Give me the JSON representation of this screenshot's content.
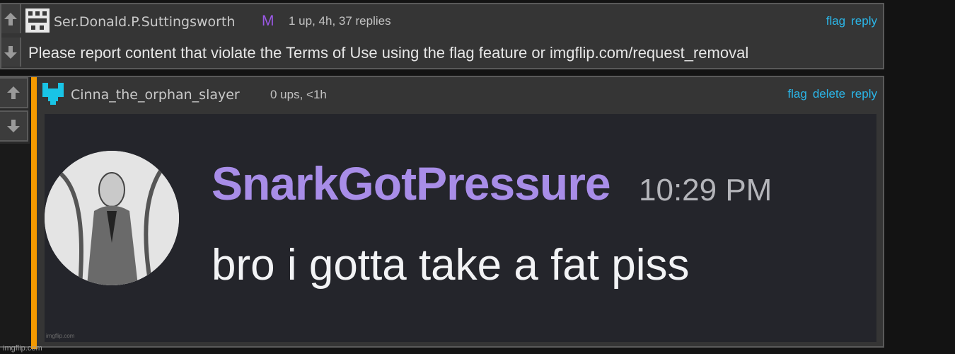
{
  "comments": [
    {
      "username": "Ser.Donald.P.Suttingsworth",
      "badge": "M",
      "meta": "1 up, 4h, 37 replies",
      "actions": {
        "flag": "flag",
        "reply": "reply"
      },
      "text": "Please report content that violate the Terms of Use using the flag feature or imgflip.com/request_removal"
    },
    {
      "username": "Cinna_the_orphan_slayer",
      "meta": "0 ups, <1h",
      "actions": {
        "flag": "flag",
        "delete": "delete",
        "reply": "reply"
      },
      "image": {
        "sender": "SnarkGotPressure",
        "time": "10:29 PM",
        "message": "bro i gotta take a fat piss",
        "watermark": "imgflip.com"
      }
    }
  ],
  "page_watermark": "imgflip.com",
  "colors": {
    "link": "#2bb6e8",
    "mod_badge": "#9b59e6",
    "reply_bar": "#f59a00",
    "discord_name": "#a88de8"
  },
  "icons": {
    "upvote": "arrow-up-icon",
    "downvote": "arrow-down-icon"
  }
}
